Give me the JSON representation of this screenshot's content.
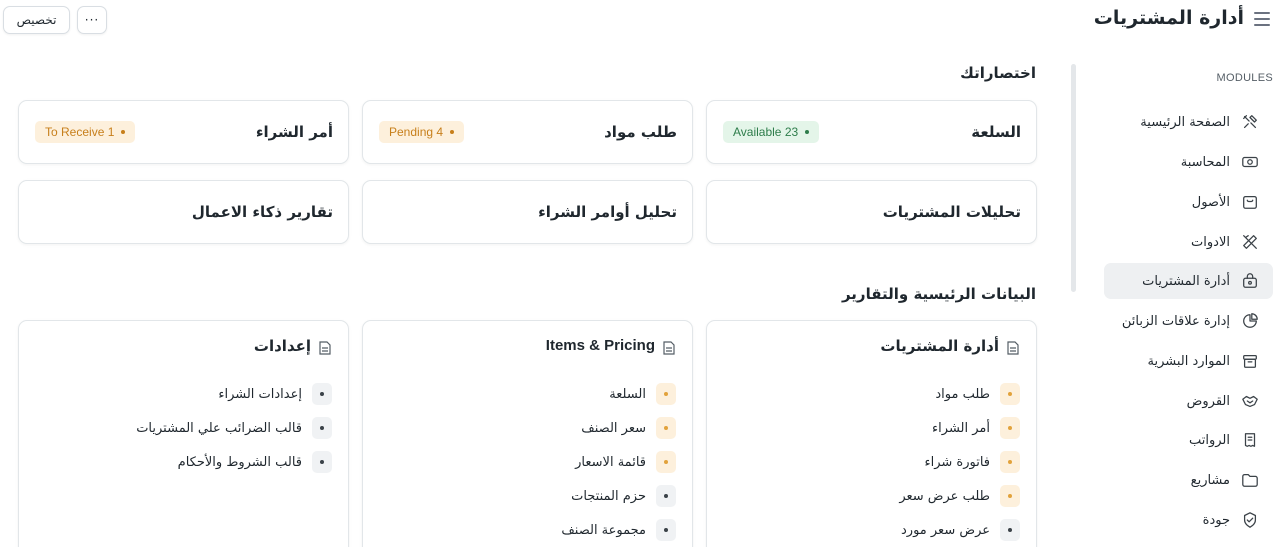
{
  "header": {
    "title": "أدارة المشتريات",
    "customize_label": "تخصيص",
    "more_label": "···"
  },
  "sidebar": {
    "modules_label": "MODULES",
    "items": [
      {
        "label": "الصفحة الرئيسية",
        "icon": "tools-icon",
        "active": false
      },
      {
        "label": "المحاسبة",
        "icon": "money-icon",
        "active": false
      },
      {
        "label": "الأصول",
        "icon": "box-icon",
        "active": false
      },
      {
        "label": "الادوات",
        "icon": "wrench-icon",
        "active": false
      },
      {
        "label": "أدارة المشتريات",
        "icon": "lock-bag-icon",
        "active": true
      },
      {
        "label": "إدارة علاقات الزبائن",
        "icon": "pie-icon",
        "active": false
      },
      {
        "label": "الموارد البشرية",
        "icon": "archive-icon",
        "active": false
      },
      {
        "label": "القروض",
        "icon": "handshake-icon",
        "active": false
      },
      {
        "label": "الرواتب",
        "icon": "receipt-icon",
        "active": false
      },
      {
        "label": "مشاريع",
        "icon": "folder-icon",
        "active": false
      },
      {
        "label": "جودة",
        "icon": "shield-icon",
        "active": false
      }
    ]
  },
  "shortcuts": {
    "title": "اختصاراتك",
    "cards": [
      {
        "label": "السلعة",
        "badge": "Available 23",
        "badge_color": "green"
      },
      {
        "label": "طلب مواد",
        "badge": "Pending 4",
        "badge_color": "orange"
      },
      {
        "label": "أمر الشراء",
        "badge": "To Receive 1",
        "badge_color": "orange"
      },
      {
        "label": "تحليلات المشتريات"
      },
      {
        "label": "تحليل أوامر الشراء"
      },
      {
        "label": "تقارير ذكاء الاعمال"
      }
    ]
  },
  "reports": {
    "title": "البيانات الرئيسية والتقارير",
    "cards": [
      {
        "title": "أدارة المشتريات",
        "items": [
          {
            "label": "طلب مواد",
            "style": "orange"
          },
          {
            "label": "أمر الشراء",
            "style": "orange"
          },
          {
            "label": "فاتورة شراء",
            "style": "orange"
          },
          {
            "label": "طلب عرض سعر",
            "style": "orange"
          },
          {
            "label": "عرض سعر مورد",
            "style": "gray"
          }
        ]
      },
      {
        "title": "Items & Pricing",
        "items": [
          {
            "label": "السلعة",
            "style": "orange"
          },
          {
            "label": "سعر الصنف",
            "style": "orange"
          },
          {
            "label": "قائمة الاسعار",
            "style": "orange"
          },
          {
            "label": "حزم المنتجات",
            "style": "gray"
          },
          {
            "label": "مجموعة الصنف",
            "style": "gray"
          }
        ]
      },
      {
        "title": "إعدادات",
        "items": [
          {
            "label": "إعدادات الشراء",
            "style": "gray"
          },
          {
            "label": "قالب الضرائب علي المشتريات",
            "style": "gray"
          },
          {
            "label": "قالب الشروط والأحكام",
            "style": "gray"
          }
        ]
      }
    ]
  }
}
